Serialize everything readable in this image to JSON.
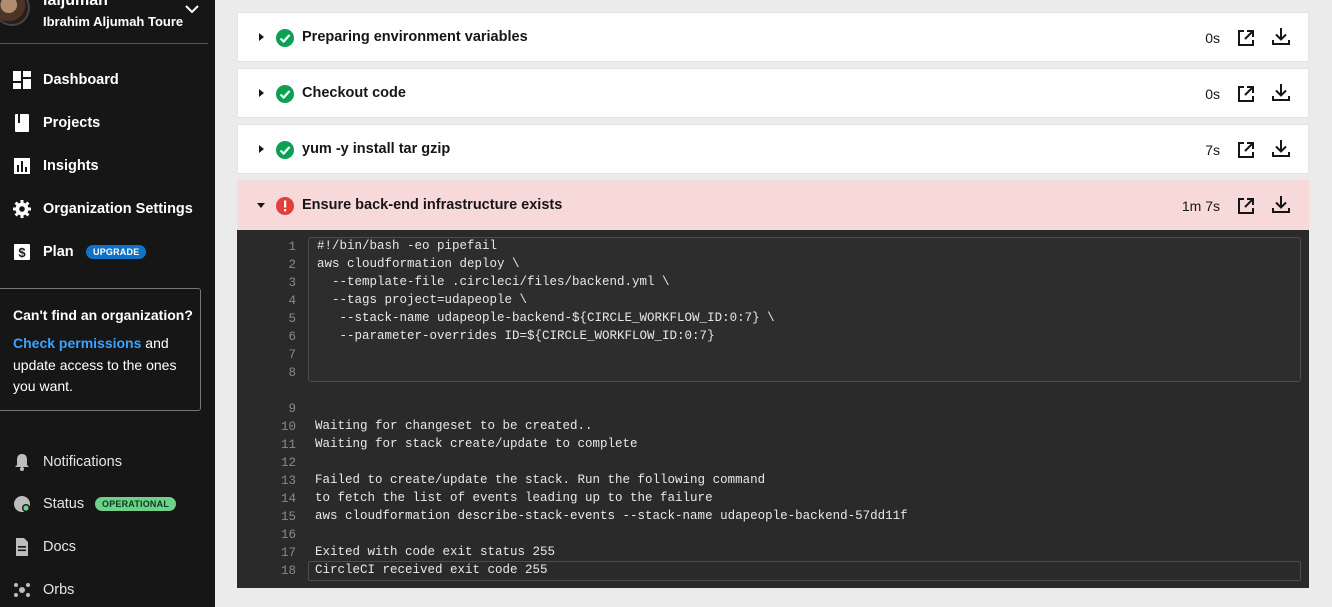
{
  "user": {
    "username": "laljuman",
    "full_name": "Ibrahim Aljumah Toure"
  },
  "nav": {
    "dashboard": "Dashboard",
    "projects": "Projects",
    "insights": "Insights",
    "org_settings": "Organization Settings",
    "plan": "Plan",
    "upgrade_badge": "UPGRADE",
    "notifications": "Notifications",
    "status": "Status",
    "status_badge": "OPERATIONAL",
    "docs": "Docs",
    "orbs": "Orbs"
  },
  "org_prompt": {
    "title": "Can't find an organization?",
    "link": "Check permissions",
    "text": " and update access to the ones you want."
  },
  "steps": [
    {
      "name": "Preparing environment variables",
      "duration": "0s",
      "status": "success"
    },
    {
      "name": "Checkout code",
      "duration": "0s",
      "status": "success"
    },
    {
      "name": "yum -y install tar gzip",
      "duration": "7s",
      "status": "success"
    },
    {
      "name": "Ensure back-end infrastructure exists",
      "duration": "1m 7s",
      "status": "failed"
    }
  ],
  "console": {
    "lines": [
      {
        "n": "1",
        "text": "#!/bin/bash -eo pipefail"
      },
      {
        "n": "2",
        "text": "aws cloudformation deploy \\"
      },
      {
        "n": "3",
        "text": "  --template-file .circleci/files/backend.yml \\"
      },
      {
        "n": "4",
        "text": "  --tags project=udapeople \\"
      },
      {
        "n": "5",
        "text": "   --stack-name udapeople-backend-${CIRCLE_WORKFLOW_ID:0:7} \\"
      },
      {
        "n": "6",
        "text": "   --parameter-overrides ID=${CIRCLE_WORKFLOW_ID:0:7}"
      },
      {
        "n": "7",
        "text": ""
      },
      {
        "n": "8",
        "text": ""
      },
      {
        "n": "9",
        "text": ""
      },
      {
        "n": "10",
        "text": "Waiting for changeset to be created.."
      },
      {
        "n": "11",
        "text": "Waiting for stack create/update to complete"
      },
      {
        "n": "12",
        "text": ""
      },
      {
        "n": "13",
        "text": "Failed to create/update the stack. Run the following command"
      },
      {
        "n": "14",
        "text": "to fetch the list of events leading up to the failure"
      },
      {
        "n": "15",
        "text": "aws cloudformation describe-stack-events --stack-name udapeople-backend-57dd11f"
      },
      {
        "n": "16",
        "text": ""
      },
      {
        "n": "17",
        "text": "Exited with code exit status 255"
      },
      {
        "n": "18",
        "text": "CircleCI received exit code 255"
      }
    ]
  },
  "colors": {
    "success": "#0d9f52",
    "failed": "#e53c3c",
    "upgrade": "#0d72c8",
    "operational": "#6fd08a",
    "link": "#3aa2ff"
  }
}
